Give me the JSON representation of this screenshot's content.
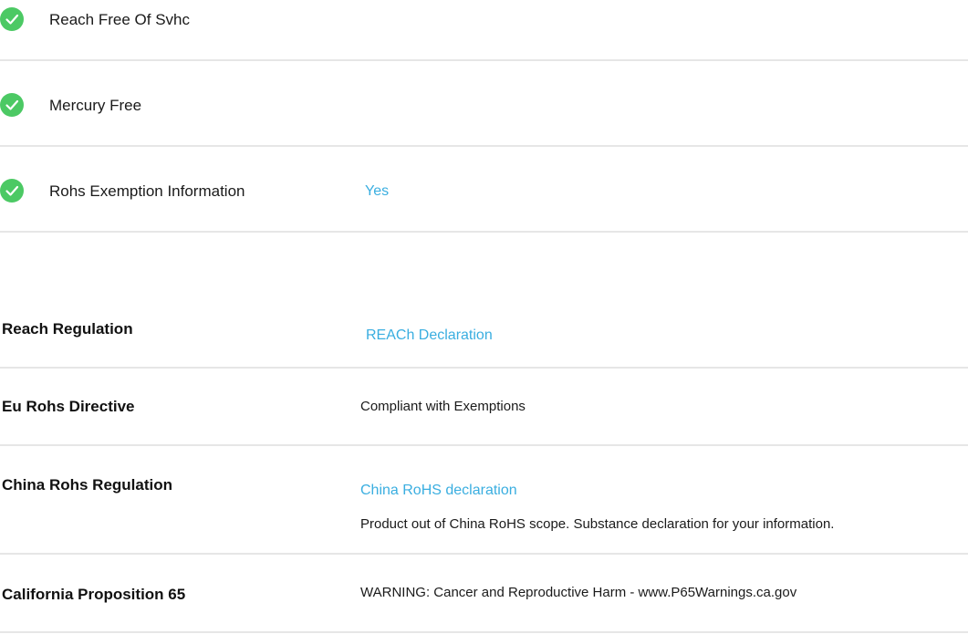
{
  "compliance_checks": [
    {
      "label": "Reach Free Of Svhc",
      "value": "",
      "icon": "check-circle-icon"
    },
    {
      "label": "Mercury Free",
      "value": "",
      "icon": "check-circle-icon"
    },
    {
      "label": "Rohs Exemption Information",
      "value": "Yes",
      "icon": "check-circle-icon"
    }
  ],
  "regulations": [
    {
      "label": "Reach Regulation",
      "link": "REACh Declaration",
      "text": ""
    },
    {
      "label": "Eu Rohs Directive",
      "link": "",
      "text": "Compliant with Exemptions"
    },
    {
      "label": "China Rohs Regulation",
      "link": "China RoHS declaration",
      "text": "Product out of China RoHS scope. Substance declaration for your information."
    },
    {
      "label": "California Proposition 65",
      "link": "",
      "text": "WARNING: Cancer and Reproductive Harm - www.P65Warnings.ca.gov"
    }
  ],
  "colors": {
    "check_green": "#4cc964",
    "link_blue": "#3aaee0",
    "divider": "#e6e6e6"
  }
}
